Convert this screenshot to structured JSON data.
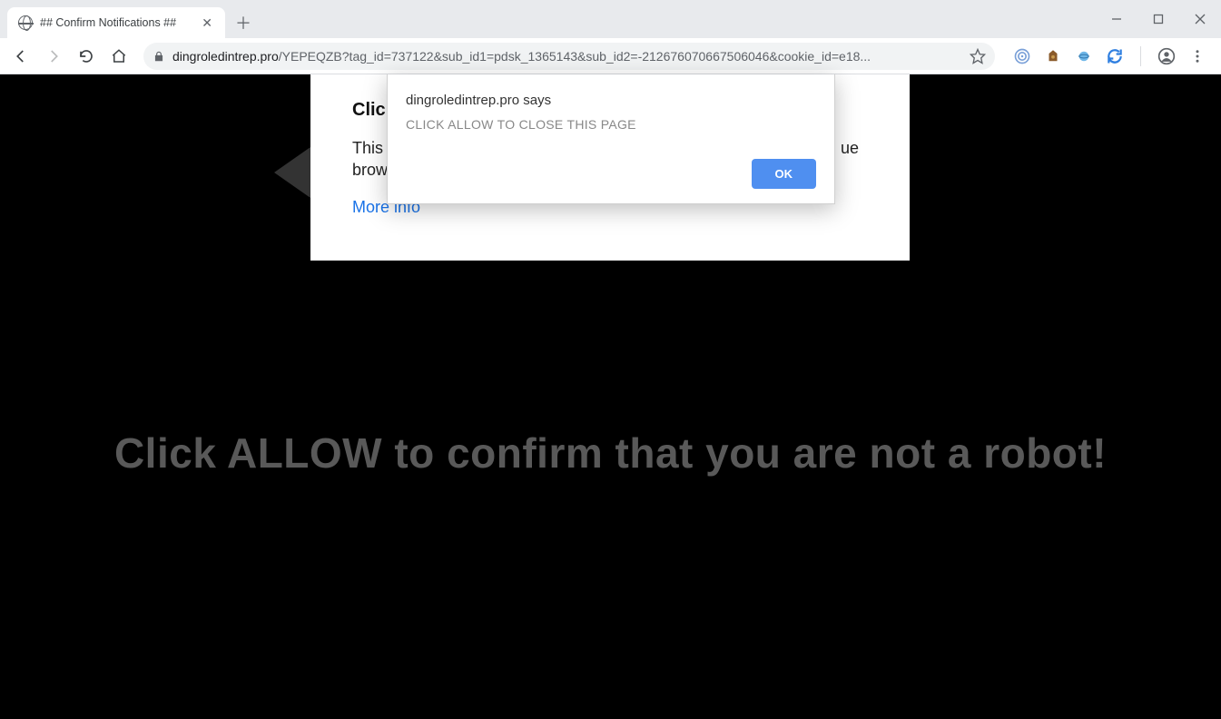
{
  "window": {
    "tab_title": "## Confirm Notifications ##",
    "minimize": "—",
    "close": "✕"
  },
  "toolbar": {
    "url_domain": "dingroledintrep.pro",
    "url_path": "/YEPEQZB?tag_id=737122&sub_id1=pdsk_1365143&sub_id2=-212676070667506046&cookie_id=e18..."
  },
  "page": {
    "big_text": "Click ALLOW to confirm that you are not a robot!",
    "panel_heading": "Click",
    "panel_line1": "This v",
    "panel_line1_tail": "ue",
    "panel_line2": "brows",
    "more_info": "More info"
  },
  "dialog": {
    "origin": "dingroledintrep.pro says",
    "message": "CLICK ALLOW TO CLOSE THIS PAGE",
    "ok": "OK"
  }
}
